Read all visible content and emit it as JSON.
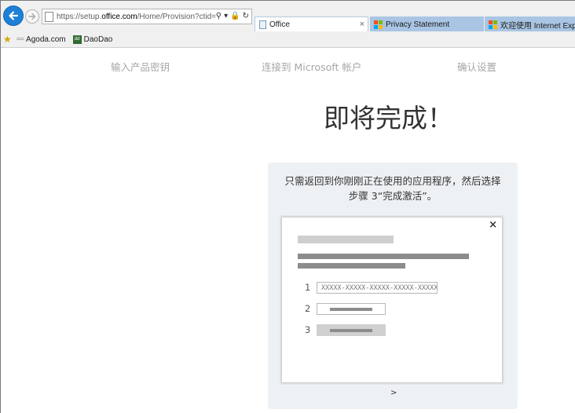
{
  "browser": {
    "address": {
      "prefix": "https://setup.",
      "domain": "office.com",
      "path": "/Home/Provision?ctid="
    },
    "tabs": [
      {
        "label": "Office",
        "active": true,
        "close": "×"
      },
      {
        "label": "Privacy Statement",
        "active": false
      },
      {
        "label": "欢迎使用 Internet Explorer",
        "active": false
      }
    ],
    "favorites": [
      {
        "label": "Agoda.com",
        "icon_text": "==="
      },
      {
        "label": "DaoDao",
        "icon_text": "dd"
      }
    ],
    "colors": {
      "accent": "#1e7fd6",
      "tab_inactive": "#a9c5e3"
    }
  },
  "page": {
    "steps": [
      "输入产品密钥",
      "连接到 Microsoft 帐户",
      "确认设置"
    ],
    "title": "即将完成！",
    "instruction_line1": "只需返回到你刚刚正在使用的应用程序，然后选择",
    "instruction_line2": "步骤 3“完成激活”。",
    "preview": {
      "close": "×",
      "numbers": [
        "1",
        "2",
        "3"
      ],
      "key_placeholder": "XXXXX-XXXXX-XXXXX-XXXXX-XXXXX"
    },
    "next": ">"
  }
}
